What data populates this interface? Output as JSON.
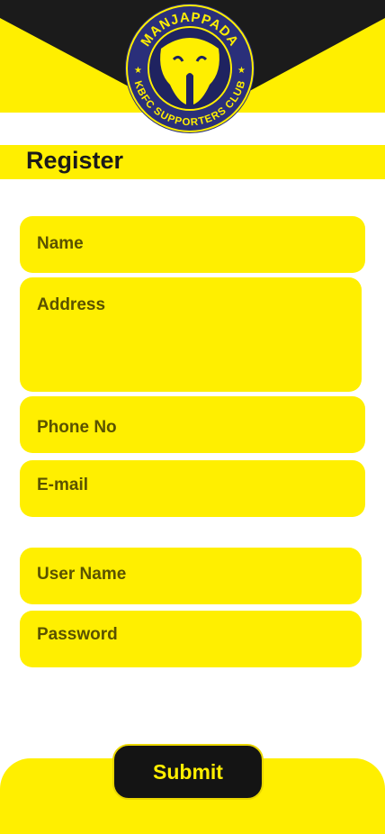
{
  "logo": {
    "top_text": "MANJAPPADA",
    "bottom_text": "KBFC SUPPORTERS CLUB"
  },
  "page": {
    "title": "Register"
  },
  "form": {
    "name_placeholder": "Name",
    "address_placeholder": "Address",
    "phone_placeholder": "Phone No",
    "email_placeholder": "E-mail",
    "username_placeholder": "User Name",
    "password_placeholder": "Password"
  },
  "actions": {
    "submit_label": "Submit"
  },
  "colors": {
    "accent": "#ffef00",
    "dark": "#141414",
    "logo_blue": "#2a2f7a"
  }
}
